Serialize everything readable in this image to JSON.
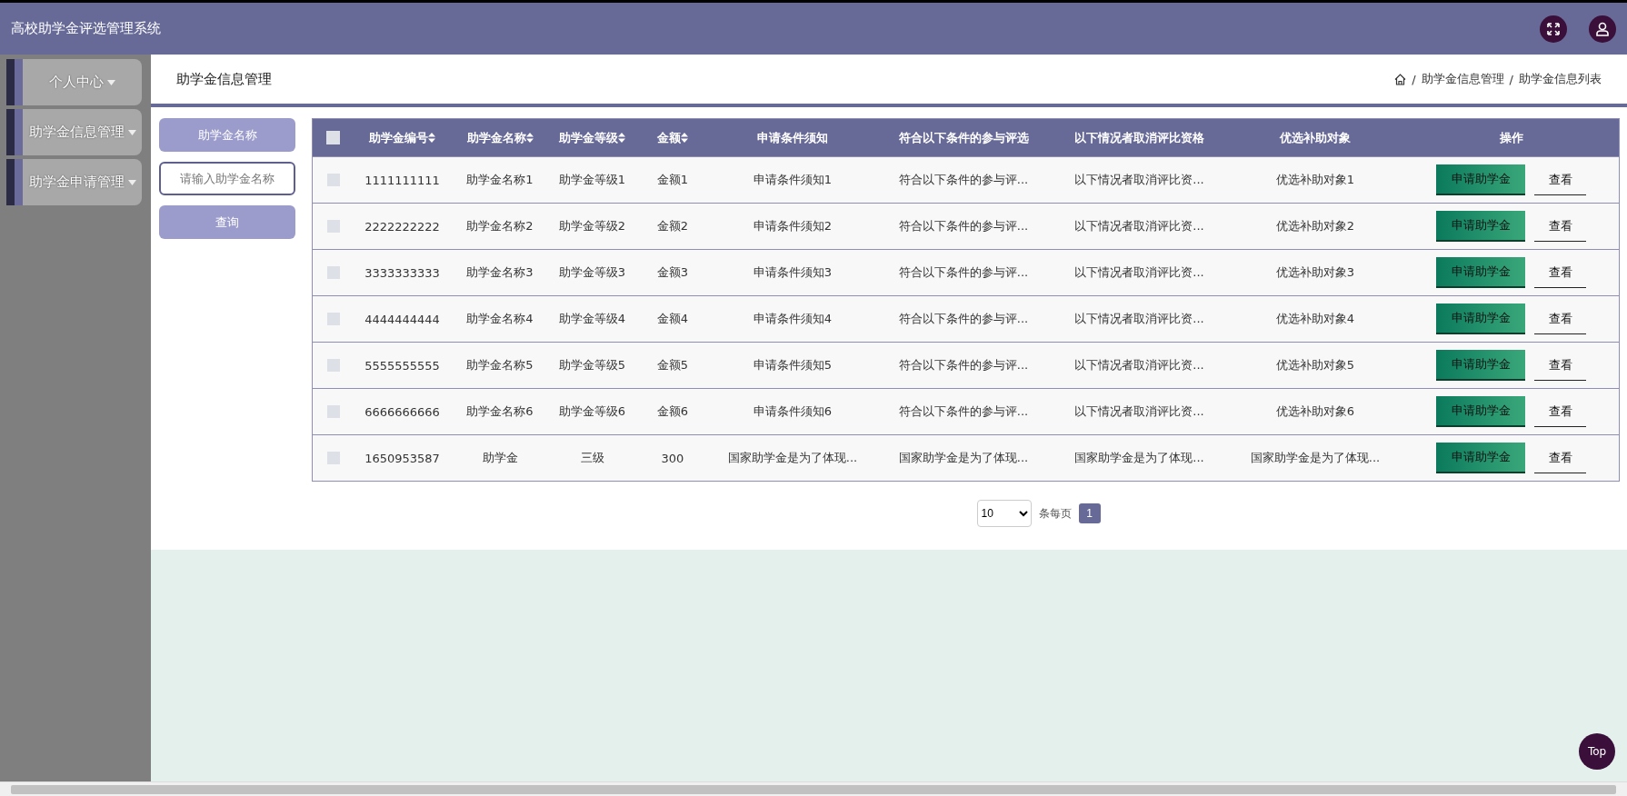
{
  "header": {
    "title": "高校助学金评选管理系统"
  },
  "sidebar": {
    "items": [
      {
        "label": "个人中心"
      },
      {
        "label": "助学金信息管理"
      },
      {
        "label": "助学金申请管理"
      }
    ]
  },
  "page_title": "助学金信息管理",
  "breadcrumb": {
    "separator": "/",
    "items": [
      "助学金信息管理",
      "助学金信息列表"
    ]
  },
  "search": {
    "label": "助学金名称",
    "placeholder": "请输入助学金名称",
    "button": "查询"
  },
  "table": {
    "all_checked": false,
    "columns": [
      {
        "label": "助学金编号",
        "sortable": true
      },
      {
        "label": "助学金名称",
        "sortable": true
      },
      {
        "label": "助学金等级",
        "sortable": true
      },
      {
        "label": "金额",
        "sortable": true
      },
      {
        "label": "申请条件须知",
        "sortable": false
      },
      {
        "label": "符合以下条件的参与评选",
        "sortable": false
      },
      {
        "label": "以下情况者取消评比资格",
        "sortable": false
      },
      {
        "label": "优选补助对象",
        "sortable": false
      },
      {
        "label": "操作",
        "sortable": false
      }
    ],
    "rows": [
      {
        "checked": false,
        "cells": [
          "1111111111",
          "助学金名称1",
          "助学金等级1",
          "金额1",
          "申请条件须知1",
          "符合以下条件的参与评...",
          "以下情况者取消评比资...",
          "优选补助对象1"
        ],
        "actions": [
          "申请助学金",
          "查看"
        ]
      },
      {
        "checked": false,
        "cells": [
          "2222222222",
          "助学金名称2",
          "助学金等级2",
          "金额2",
          "申请条件须知2",
          "符合以下条件的参与评...",
          "以下情况者取消评比资...",
          "优选补助对象2"
        ],
        "actions": [
          "申请助学金",
          "查看"
        ]
      },
      {
        "checked": false,
        "cells": [
          "3333333333",
          "助学金名称3",
          "助学金等级3",
          "金额3",
          "申请条件须知3",
          "符合以下条件的参与评...",
          "以下情况者取消评比资...",
          "优选补助对象3"
        ],
        "actions": [
          "申请助学金",
          "查看"
        ]
      },
      {
        "checked": false,
        "cells": [
          "4444444444",
          "助学金名称4",
          "助学金等级4",
          "金额4",
          "申请条件须知4",
          "符合以下条件的参与评...",
          "以下情况者取消评比资...",
          "优选补助对象4"
        ],
        "actions": [
          "申请助学金",
          "查看"
        ]
      },
      {
        "checked": false,
        "cells": [
          "5555555555",
          "助学金名称5",
          "助学金等级5",
          "金额5",
          "申请条件须知5",
          "符合以下条件的参与评...",
          "以下情况者取消评比资...",
          "优选补助对象5"
        ],
        "actions": [
          "申请助学金",
          "查看"
        ]
      },
      {
        "checked": false,
        "cells": [
          "6666666666",
          "助学金名称6",
          "助学金等级6",
          "金额6",
          "申请条件须知6",
          "符合以下条件的参与评...",
          "以下情况者取消评比资...",
          "优选补助对象6"
        ],
        "actions": [
          "申请助学金",
          "查看"
        ]
      },
      {
        "checked": false,
        "cells": [
          "1650953587",
          "助学金",
          "三级",
          "300",
          "国家助学金是为了体现...",
          "国家助学金是为了体现...",
          "国家助学金是为了体现...",
          "国家助学金是为了体现..."
        ],
        "actions": [
          "申请助学金",
          "查看"
        ]
      }
    ]
  },
  "pagination": {
    "page_size": "10",
    "page_size_label": "条每页",
    "pages": [
      {
        "label": "1",
        "selected": true
      }
    ]
  },
  "top_button": "Top"
}
